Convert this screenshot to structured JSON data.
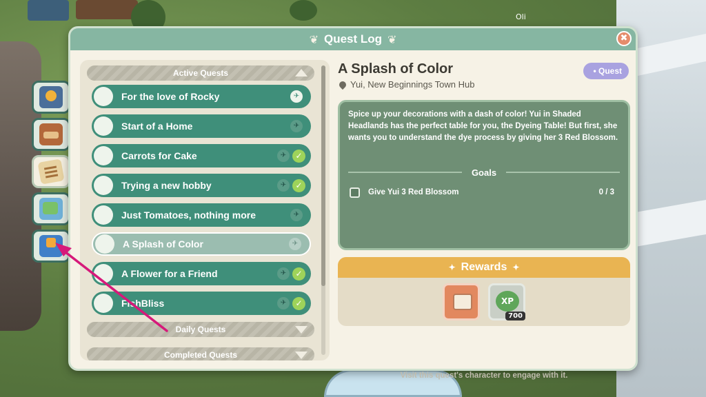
{
  "world": {
    "player_name": "Oli"
  },
  "window": {
    "title": "Quest Log",
    "close_glyph": "✖"
  },
  "sidebar": {
    "tabs": [
      {
        "icon": "book-icon",
        "active": false
      },
      {
        "icon": "backpack-icon",
        "active": false
      },
      {
        "icon": "scroll-icon",
        "active": true
      },
      {
        "icon": "map-icon",
        "active": false
      },
      {
        "icon": "quest-journal-icon",
        "active": false
      }
    ]
  },
  "quest_list": {
    "active_header": "Active Quests",
    "daily_header": "Daily Quests",
    "completed_header": "Completed Quests",
    "quests": [
      {
        "name": "For the love of Rocky",
        "tracked": true,
        "complete": false,
        "selected": false
      },
      {
        "name": "Start of a Home",
        "tracked": false,
        "complete": false,
        "selected": false
      },
      {
        "name": "Carrots for Cake",
        "tracked": false,
        "complete": true,
        "selected": false
      },
      {
        "name": "Trying a new hobby",
        "tracked": false,
        "complete": true,
        "selected": false
      },
      {
        "name": "Just Tomatoes, nothing more",
        "tracked": false,
        "complete": false,
        "selected": false
      },
      {
        "name": "A Splash of Color",
        "tracked": false,
        "complete": false,
        "selected": true
      },
      {
        "name": "A Flower for a Friend",
        "tracked": false,
        "complete": true,
        "selected": false
      },
      {
        "name": "FishBliss",
        "tracked": false,
        "complete": true,
        "selected": false
      }
    ]
  },
  "detail": {
    "title": "A Splash of Color",
    "location": "Yui, New Beginnings Town Hub",
    "badge": "• Quest",
    "description": "Spice up your decorations with a dash of color! Yui in Shaded Headlands has the perfect table for you, the Dyeing Table! But first, she wants you to understand the dye process by giving her 3 Red Blossom.",
    "goals_label": "Goals",
    "goals": [
      {
        "text": "Give Yui 3 Red Blossom",
        "progress": "0 / 3"
      }
    ],
    "rewards_label": "Rewards",
    "reward_xp_label": "XP",
    "reward_xp_amount": "700",
    "hint": "Visit this quest's character to engage with it."
  },
  "colors": {
    "quest_row": "#3f8f7a",
    "quest_row_selected": "#9bbdb0",
    "description_bg": "#6f8f75",
    "rewards_header": "#e9b452",
    "badge": "#a9a2e0",
    "annotation_arrow": "#d6197a"
  }
}
